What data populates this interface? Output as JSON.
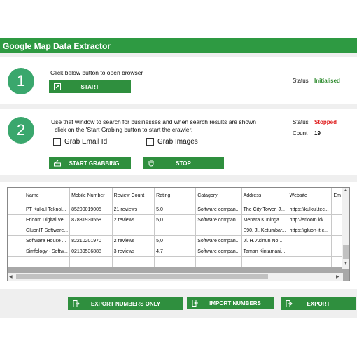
{
  "app": {
    "title": "Google Map Data Extractor"
  },
  "step1": {
    "number": "1",
    "instruction": "Click below button to open browser",
    "start_label": "START",
    "status_label": "Status",
    "status_value": "Initialised",
    "status_color": "#2e8b2e"
  },
  "step2": {
    "number": "2",
    "instruction_line1": "Use that window to search for businesses and when search results are shown",
    "instruction_line2": "click on the 'Start Grabing button to start the crawler.",
    "status_label": "Status",
    "status_value": "Stopped",
    "status_color": "#e02020",
    "count_label": "Count",
    "count_value": "19",
    "grab_email_label": "Grab Email Id",
    "grab_email_checked": false,
    "grab_images_label": "Grab Images",
    "grab_images_checked": false,
    "start_grabbing_label": "START GRABBING",
    "stop_label": "STOP"
  },
  "table": {
    "columns": [
      "Name",
      "Mobile Number",
      "Review Count",
      "Rating",
      "Catagory",
      "Address",
      "Website",
      "Em"
    ],
    "rows": [
      [
        "PT Kulkul Teknol...",
        "85200019005",
        "21 reviews",
        "5,0",
        "Software compan...",
        "The City Tower, J...",
        "https://kulkul.tec...",
        ""
      ],
      [
        "Erloom Digital Ve...",
        "87881930558",
        "2 reviews",
        "5,0",
        "Software compan...",
        "Menara Kuninga...",
        "http://erloom.id/",
        ""
      ],
      [
        "GluonIT Software...",
        "",
        "",
        "",
        "",
        "E90, Jl. Ketumbar...",
        "https://gluon-it.c...",
        ""
      ],
      [
        "Software House ...",
        "82210201970",
        "2 reviews",
        "5,0",
        "Software compan...",
        "Jl. H. Asinun No...",
        "",
        ""
      ],
      [
        "Simfology - Softw...",
        "02189536888",
        "3 reviews",
        "4,7",
        "Software compan...",
        "Taman Kintamani...",
        "",
        ""
      ]
    ]
  },
  "footer": {
    "export_numbers_only_label": "EXPORT NUMBERS ONLY",
    "import_numbers_label": "IMPORT NUMBERS",
    "export_label": "EXPORT"
  }
}
